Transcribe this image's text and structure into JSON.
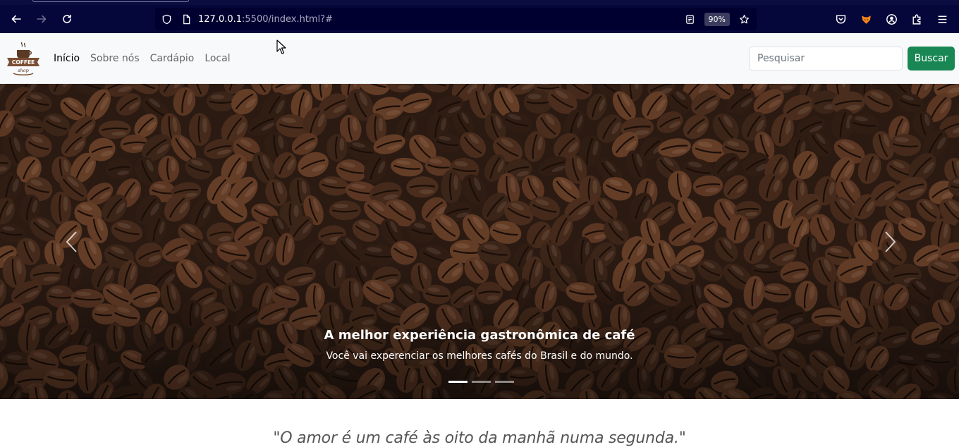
{
  "browser": {
    "url_host": "127.0.0.1",
    "url_rest": ":5500/index.html?#",
    "zoom": "90%"
  },
  "site": {
    "logo_text_top": "COFFEE",
    "logo_text_bottom": "shop",
    "nav": {
      "items": [
        {
          "label": "Início",
          "active": true
        },
        {
          "label": "Sobre nós",
          "active": false
        },
        {
          "label": "Cardápio",
          "active": false
        },
        {
          "label": "Local",
          "active": false
        }
      ]
    },
    "search": {
      "placeholder": "Pesquisar",
      "button_label": "Buscar"
    }
  },
  "carousel": {
    "caption_title": "A melhor experiência gastronômica de café",
    "caption_text": "Você vai experenciar os melhores cafés do Brasil e do mundo.",
    "slides": 3,
    "active_slide": 1
  },
  "quote": {
    "text": "\"O amor é um café às oito da manhã numa segunda.\""
  },
  "colors": {
    "browser_bg": "#05063a",
    "navbar_bg": "#f8f9fa",
    "button_green": "#198754",
    "bean_dark": "#2a1a12"
  }
}
